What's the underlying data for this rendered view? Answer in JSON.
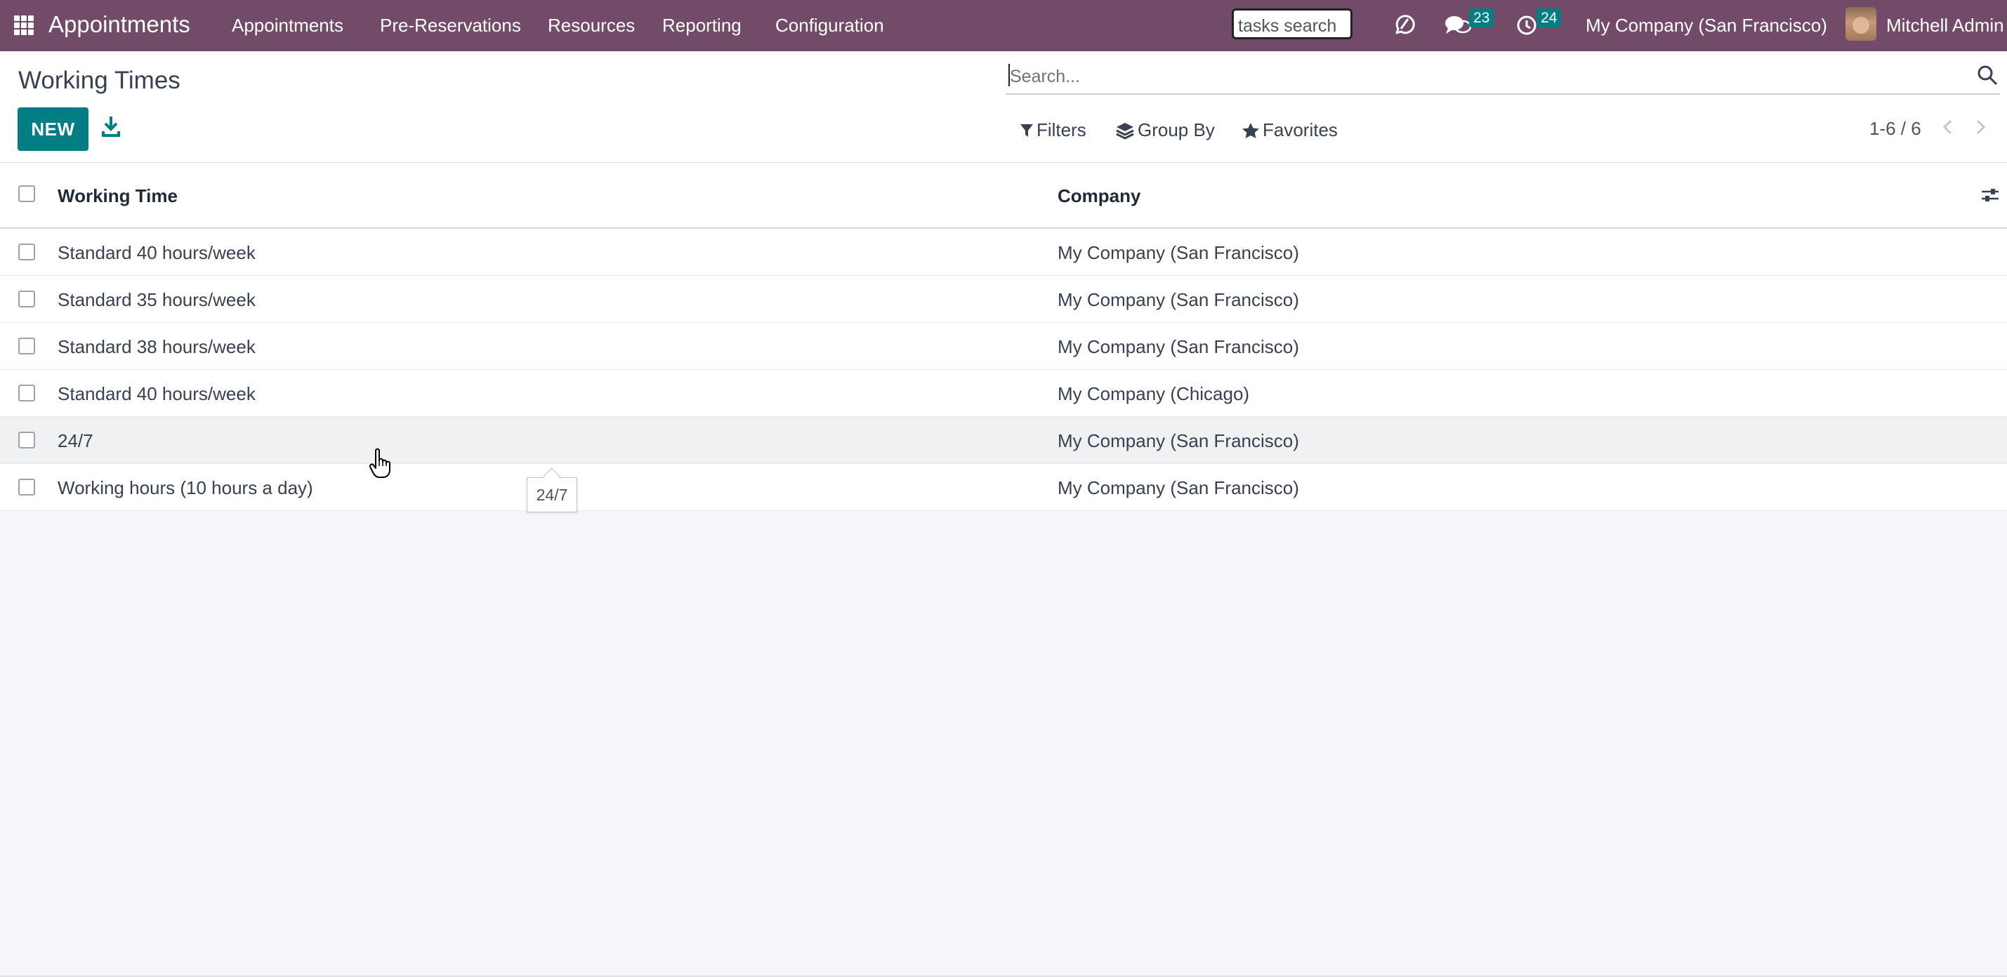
{
  "navbar": {
    "brand": "Appointments",
    "menu": [
      "Appointments",
      "Pre-Reservations",
      "Resources",
      "Reporting",
      "Configuration"
    ],
    "tasks_search": "tasks search",
    "messages_count": "23",
    "activities_count": "24",
    "company": "My Company (San Francisco)",
    "user": "Mitchell Admin"
  },
  "control_panel": {
    "breadcrumb": "Working Times",
    "new_label": "NEW",
    "search_placeholder": "Search...",
    "filters_label": "Filters",
    "group_by_label": "Group By",
    "favorites_label": "Favorites",
    "pager": "1-6 / 6"
  },
  "list": {
    "columns": [
      "Working Time",
      "Company"
    ],
    "rows": [
      {
        "name": "Standard 40 hours/week",
        "company": "My Company (San Francisco)"
      },
      {
        "name": "Standard 35 hours/week",
        "company": "My Company (San Francisco)"
      },
      {
        "name": "Standard 38 hours/week",
        "company": "My Company (San Francisco)"
      },
      {
        "name": "Standard 40 hours/week",
        "company": "My Company (Chicago)"
      },
      {
        "name": "24/7",
        "company": "My Company (San Francisco)"
      },
      {
        "name": "Working hours (10 hours a day)",
        "company": "My Company (San Francisco)"
      }
    ]
  },
  "tooltip": "24/7",
  "colors": {
    "navbar": "#714b67",
    "primary": "#017e84",
    "background": "#f5f6f9"
  }
}
